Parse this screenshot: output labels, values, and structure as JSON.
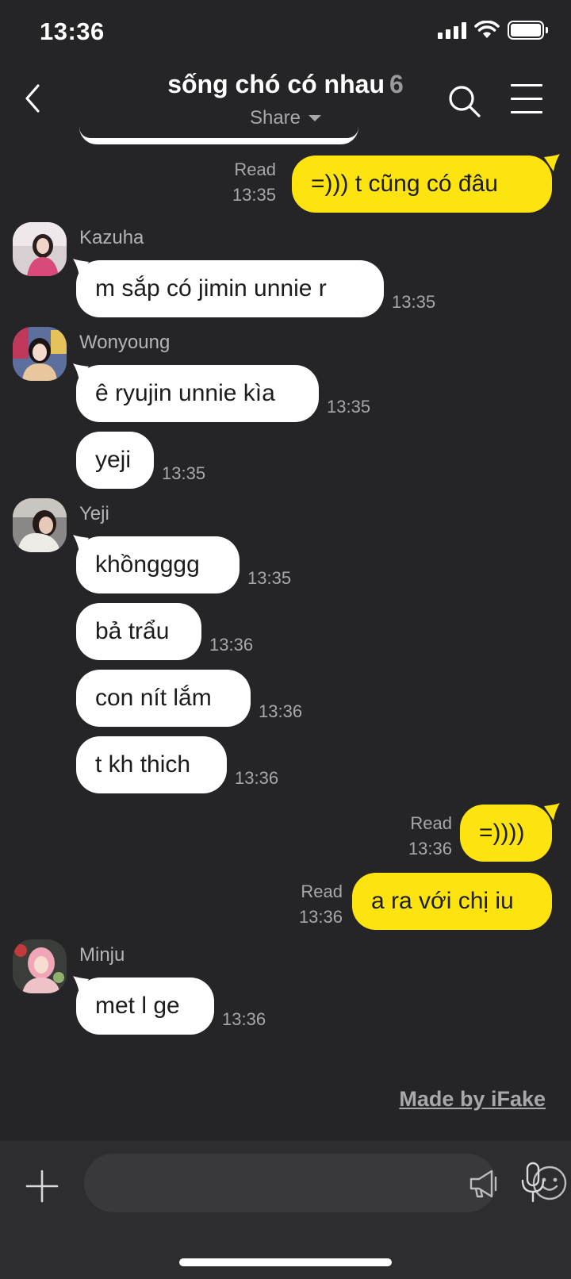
{
  "status_bar": {
    "time": "13:36"
  },
  "header": {
    "title": "sống chó có nhau",
    "member_count": "6",
    "share_label": "Share"
  },
  "messages": [
    {
      "direction": "out",
      "text": "=))) t cũng có đâu",
      "read": "Read",
      "time": "13:35"
    },
    {
      "direction": "in",
      "sender": "Kazuha",
      "text": "m sắp có jimin unnie r",
      "time": "13:35"
    },
    {
      "direction": "in",
      "sender": "Wonyoung",
      "text": "ê ryujin unnie kìa",
      "time": "13:35"
    },
    {
      "direction": "in",
      "text": "yeji",
      "time": "13:35"
    },
    {
      "direction": "in",
      "sender": "Yeji",
      "text": "khồngggg",
      "time": "13:35"
    },
    {
      "direction": "in",
      "text": "bả trẩu",
      "time": "13:36"
    },
    {
      "direction": "in",
      "text": "con nít lắm",
      "time": "13:36"
    },
    {
      "direction": "in",
      "text": "t kh thich",
      "time": "13:36"
    },
    {
      "direction": "out",
      "text": "=))))",
      "read": "Read",
      "time": "13:36"
    },
    {
      "direction": "out",
      "text": "a ra với chị iu",
      "read": "Read",
      "time": "13:36"
    },
    {
      "direction": "in",
      "sender": "Minju",
      "text": "met l ge",
      "time": "13:36"
    }
  ],
  "watermark": "Made by iFake",
  "input": {
    "placeholder": ""
  },
  "colors": {
    "background": "#252528",
    "outgoing_bubble": "#fde30f",
    "incoming_bubble": "#ffffff",
    "meta_text": "#a8a8aa"
  }
}
